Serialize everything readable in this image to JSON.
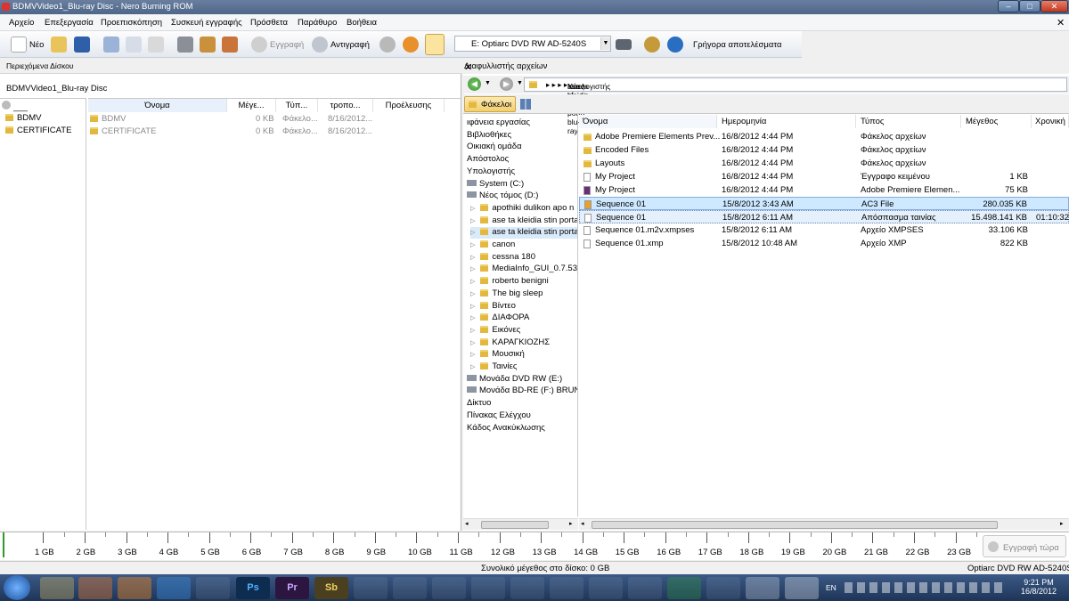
{
  "window": {
    "title": "BDMVVideo1_Blu-ray Disc - Nero Burning ROM",
    "min": "–",
    "max": "□",
    "close": "✕"
  },
  "menu": {
    "items": [
      "Αρχείο",
      "Επεξεργασία",
      "Προεπισκόπηση",
      "Συσκευή εγγραφής",
      "Πρόσθετα",
      "Παράθυρο",
      "Βοήθεια"
    ],
    "close": "✕"
  },
  "toolbar": {
    "new": "Νέο",
    "burn": "Εγγραφή",
    "copy": "Αντιγραφή",
    "drive": "E: Optiarc DVD RW AD-5240S",
    "quick": "Γρήγορα αποτελέσματα"
  },
  "left": {
    "header": "Περιεχόμενα Δίσκου",
    "disc": "BDMVVideo1_Blu-ray Disc",
    "tree_root": "___",
    "tree": [
      "BDMV",
      "CERTIFICATE"
    ],
    "columns": [
      "Όνομα",
      "Μέγε...",
      "Τύπ...",
      "τροπο...",
      "Προέλευσης"
    ],
    "rows": [
      {
        "name": "BDMV",
        "size": "0 KB",
        "type": "Φάκελο...",
        "date": "8/16/2012..."
      },
      {
        "name": "CERTIFICATE",
        "size": "0 KB",
        "type": "Φάκελο...",
        "date": "8/16/2012..."
      }
    ]
  },
  "right": {
    "header": "Διαφυλλιστής αρχείων",
    "close": "✕",
    "address": [
      "Υπολογιστής",
      "Νέος τόμος (D:)",
      "ase ta kleidia stin porta blu-ray"
    ],
    "folders_btn": "Φάκελοι",
    "tree": [
      {
        "label": "ιφάνεια εργασίας",
        "indent": 0
      },
      {
        "label": "Βιβλιοθήκες",
        "indent": 0
      },
      {
        "label": "Οικιακή ομάδα",
        "indent": 0
      },
      {
        "label": "Απόστολος",
        "indent": 0
      },
      {
        "label": "Υπολογιστής",
        "indent": 0
      },
      {
        "label": "System (C:)",
        "indent": 1
      },
      {
        "label": "Νέος τόμος (D:)",
        "indent": 1
      },
      {
        "label": "apothiki dulikon apo n",
        "indent": 2
      },
      {
        "label": "ase ta kleidia stin porta",
        "indent": 2
      },
      {
        "label": "ase ta kleidia stin porta",
        "indent": 2
      },
      {
        "label": "canon",
        "indent": 2
      },
      {
        "label": "cessna 180",
        "indent": 2
      },
      {
        "label": "MediaInfo_GUI_0.7.53_",
        "indent": 2
      },
      {
        "label": "roberto benigni",
        "indent": 2
      },
      {
        "label": "The big sleep",
        "indent": 2
      },
      {
        "label": "Βίντεο",
        "indent": 2
      },
      {
        "label": "ΔΙΑΦΟΡΑ",
        "indent": 2
      },
      {
        "label": "Εικόνες",
        "indent": 2
      },
      {
        "label": "ΚΑΡΑΓΚΙΟΖΗΣ",
        "indent": 2
      },
      {
        "label": "Μουσική",
        "indent": 2
      },
      {
        "label": "Ταινίες",
        "indent": 2
      },
      {
        "label": "Μονάδα DVD RW (E:)",
        "indent": 1
      },
      {
        "label": "Μονάδα BD-RE (F:) BRUN",
        "indent": 1
      },
      {
        "label": "Δίκτυο",
        "indent": 0
      },
      {
        "label": "Πίνακας Ελέγχου",
        "indent": 0
      },
      {
        "label": "Κάδος Ανακύκλωσης",
        "indent": 0
      }
    ],
    "columns": [
      "Όνομα",
      "Ημερομηνία",
      "Τύπος",
      "Μέγεθος",
      "Χρονική"
    ],
    "files": [
      {
        "name": "Adobe Premiere Elements Prev...",
        "date": "16/8/2012 4:44 PM",
        "type": "Φάκελος αρχείων",
        "size": "",
        "dur": ""
      },
      {
        "name": "Encoded Files",
        "date": "16/8/2012 4:44 PM",
        "type": "Φάκελος αρχείων",
        "size": "",
        "dur": ""
      },
      {
        "name": "Layouts",
        "date": "16/8/2012 4:44 PM",
        "type": "Φάκελος αρχείων",
        "size": "",
        "dur": ""
      },
      {
        "name": "My Project",
        "date": "16/8/2012 4:44 PM",
        "type": "Έγγραφο κειμένου",
        "size": "1 KB",
        "dur": ""
      },
      {
        "name": "My Project",
        "date": "16/8/2012 4:44 PM",
        "type": "Adobe Premiere Elemen...",
        "size": "75 KB",
        "dur": ""
      },
      {
        "name": "Sequence 01",
        "date": "15/8/2012 3:43 AM",
        "type": "AC3 File",
        "size": "280.035 KB",
        "dur": ""
      },
      {
        "name": "Sequence 01",
        "date": "15/8/2012 6:11 AM",
        "type": "Απόσπασμα ταινίας",
        "size": "15.498.141 KB",
        "dur": "01:10:32"
      },
      {
        "name": "Sequence 01.m2v.xmpses",
        "date": "15/8/2012 6:11 AM",
        "type": "Αρχείο XMPSES",
        "size": "33.106 KB",
        "dur": ""
      },
      {
        "name": "Sequence 01.xmp",
        "date": "15/8/2012 10:48 AM",
        "type": "Αρχείο XMP",
        "size": "822 KB",
        "dur": ""
      }
    ]
  },
  "ruler": {
    "ticks": [
      "1 GB",
      "2 GB",
      "3 GB",
      "4 GB",
      "5 GB",
      "6 GB",
      "7 GB",
      "8 GB",
      "9 GB",
      "10 GB",
      "11 GB",
      "12 GB",
      "13 GB",
      "14 GB",
      "15 GB",
      "16 GB",
      "17 GB",
      "18 GB",
      "19 GB",
      "20 GB",
      "21 GB",
      "22 GB",
      "23 GB"
    ],
    "burn_now": "Εγγραφή τώρα"
  },
  "status": {
    "total": "Συνολικό μέγεθος στο δίσκο: 0 GB",
    "drive": "Optiarc  DVD RW AD-5240S"
  },
  "taskbar": {
    "lang": "EN",
    "time": "9:21 PM",
    "date": "16/8/2012",
    "apps": [
      "Ps",
      "Pr",
      "Sb"
    ]
  },
  "colors": {
    "accent": "#3399ff",
    "selection": "#cde8ff",
    "folder": "#e3b83e"
  }
}
